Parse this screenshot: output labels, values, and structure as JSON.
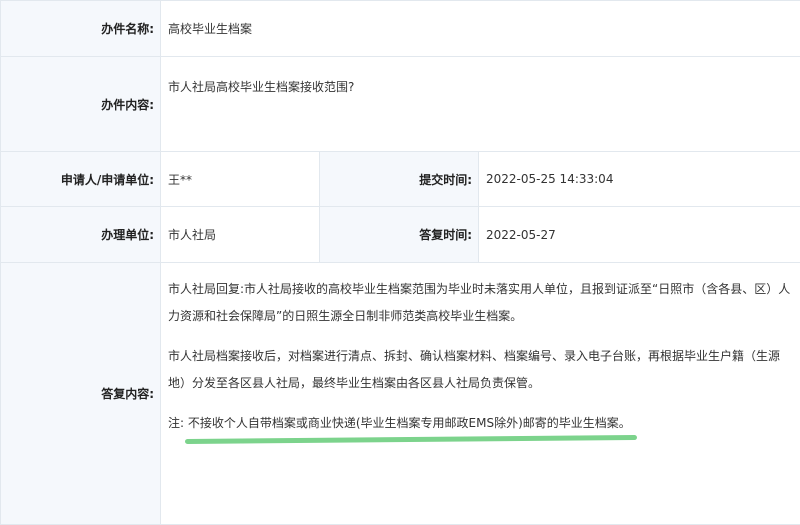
{
  "form": {
    "case_name": {
      "label": "办件名称:",
      "value": "高校毕业生档案"
    },
    "case_content": {
      "label": "办件内容:",
      "value": "市人社局高校毕业生档案接收范围?"
    },
    "applicant": {
      "label": "申请人/申请单位:",
      "value": "王**"
    },
    "submit_time": {
      "label": "提交时间:",
      "value": "2022-05-25 14:33:04"
    },
    "handling_unit": {
      "label": "办理单位:",
      "value": "市人社局"
    },
    "reply_time": {
      "label": "答复时间:",
      "value": "2022-05-27"
    },
    "reply": {
      "label": "答复内容:",
      "paragraph1": "市人社局回复:市人社局接收的高校毕业生档案范围为毕业时未落实用人单位，且报到证派至“日照市（含各县、区）人力资源和社会保障局”的日照生源全日制非师范类高校毕业生档案。",
      "paragraph2": "市人社局档案接收后，对档案进行清点、拆封、确认档案材料、档案编号、录入电子台账，再根据毕业生户籍（生源地）分发至各区县人社局，最终毕业生档案由各区县人社局负责保管。",
      "note_prefix": "注:",
      "note_text": "不接收个人自带档案或商业快递(毕业生档案专用邮政EMS除外)邮寄的毕业生档案。",
      "highlight_color": "#7cd38c"
    }
  }
}
